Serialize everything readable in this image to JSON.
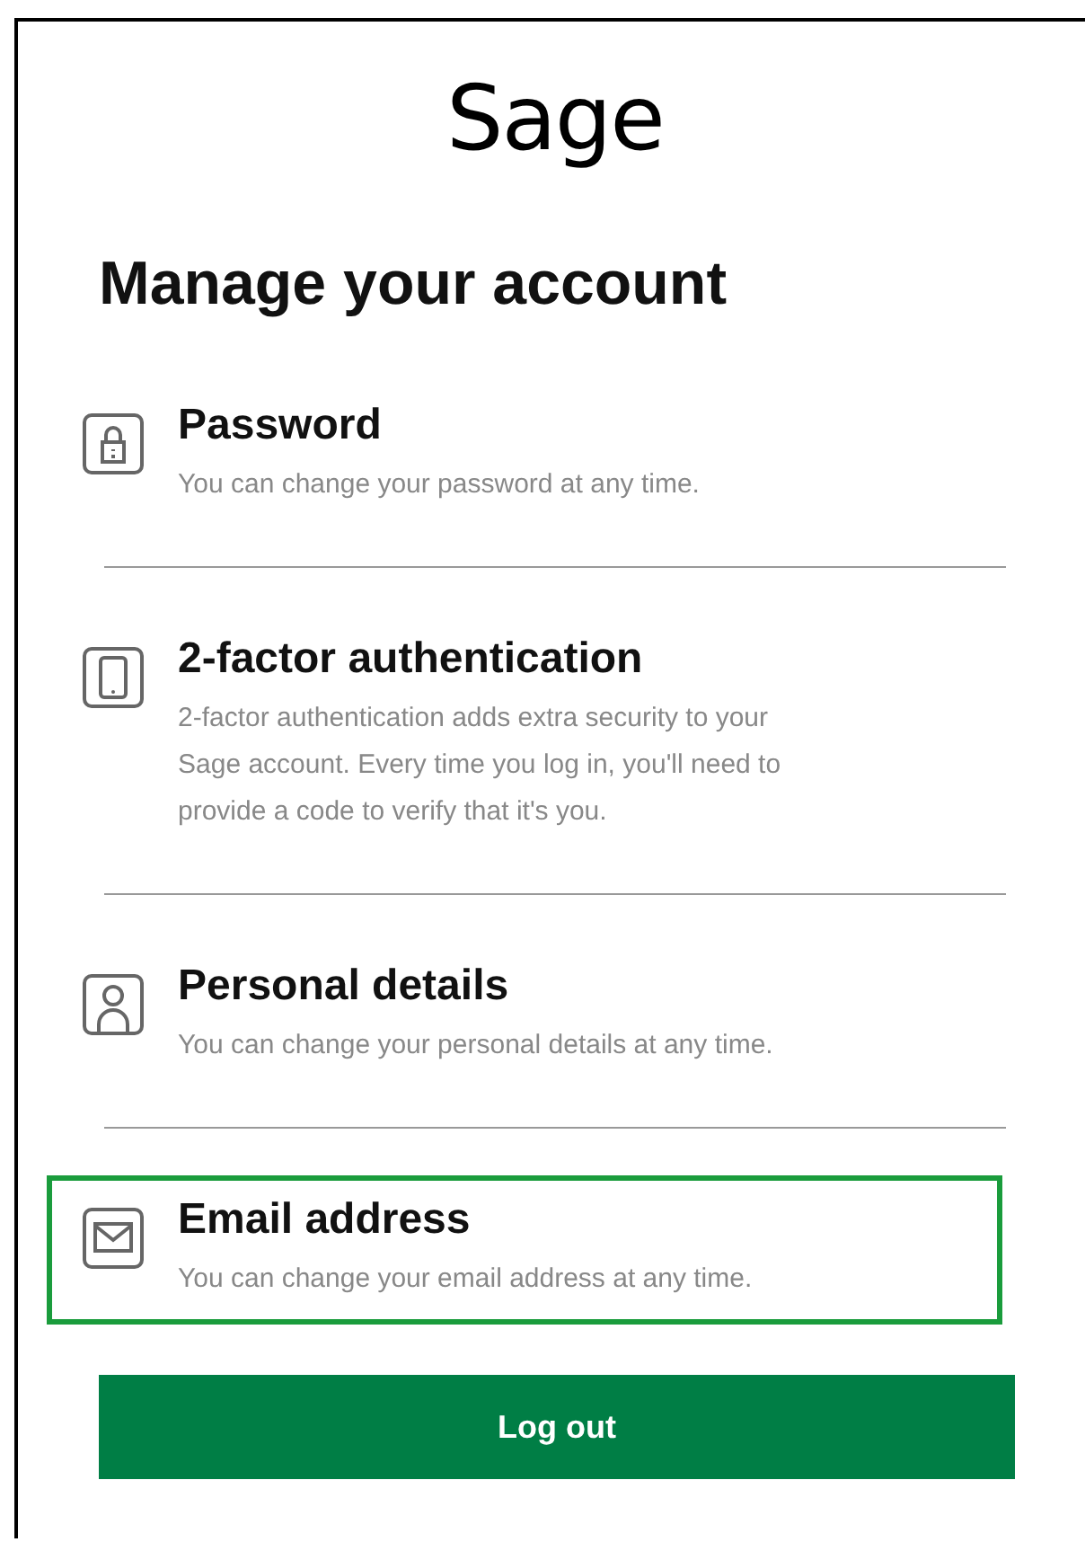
{
  "logo": "Sage",
  "heading": "Manage your account",
  "items": [
    {
      "kind": "lock",
      "title": "Password",
      "description_lines": [
        "You can change your password at any time."
      ],
      "highlighted": false
    },
    {
      "kind": "phone",
      "title": "2-factor authentication",
      "description_lines": [
        "2-factor authentication adds extra security to your",
        "Sage account. Every time you log in, you'll need to",
        "provide a code to verify that it's you."
      ],
      "highlighted": false
    },
    {
      "kind": "person",
      "title": "Personal details",
      "description_lines": [
        "You can change your personal details at any time."
      ],
      "highlighted": false
    },
    {
      "kind": "mail",
      "title": "Email address",
      "description_lines": [
        "You can change your email address at any time."
      ],
      "highlighted": true
    }
  ],
  "logout_button": "Log out"
}
